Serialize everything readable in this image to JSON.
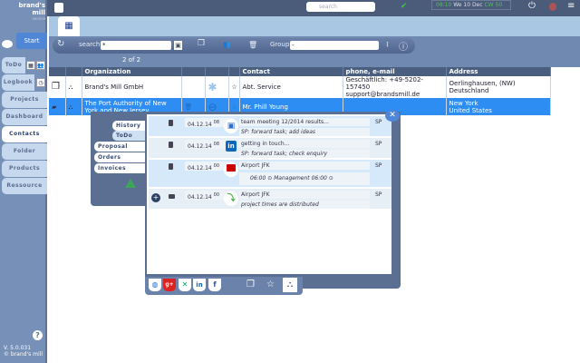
{
  "topbar": {
    "search_placeholder": "search",
    "time": "08:10",
    "date": "We 10 Dec",
    "week": "CW 50"
  },
  "sidebar": {
    "brand": "brand's mill",
    "brand_sub": "service",
    "start": "Start",
    "items": [
      "ToDo",
      "Logbook",
      "Projects",
      "Dashboard",
      "Contacts",
      "Folder",
      "Products",
      "Ressource"
    ],
    "active": "Contacts",
    "version": "V. 5.0.031",
    "copyright": "© brand's mill"
  },
  "toolbar": {
    "search_label": "search",
    "search_value": "*",
    "group_label": "Group",
    "group_value": "-",
    "count": "2 of 2"
  },
  "table": {
    "headers": [
      "Organization",
      "Contact",
      "phone, e-mail",
      "Address"
    ],
    "rows": [
      {
        "organization": "Brand's Mill GmbH",
        "contact": "Abt. Service",
        "phone": "Geschäftlich: +49-5202-157450",
        "email": "support@brandsmill.de",
        "address1": "Oerlinghausen, (NW)",
        "address2": "Deutschland",
        "selected": false
      },
      {
        "organization": "The Port Authority of New York and New Jersey",
        "contact": "Mr. Phill Young",
        "phone": "",
        "email": "",
        "address1": "New York",
        "address2": "United States",
        "selected": true
      }
    ]
  },
  "panel": {
    "tabs": [
      "History",
      "ToDo",
      "Proposal",
      "Orders",
      "Invoices"
    ],
    "activities": [
      {
        "date": "04.12.14",
        "time": "08",
        "icon": "contact-card-icon",
        "line1": "team meeting 12/2014 results...",
        "line2": "SP: forward task; add ideas",
        "user": "SP"
      },
      {
        "date": "04.12.14",
        "time": "08",
        "icon": "linkedin-icon",
        "line1": "getting in touch...",
        "line2": "SP: forward task; check enquiry",
        "user": "SP"
      },
      {
        "date": "04.12.14",
        "time": "00",
        "icon": "briefcase-icon",
        "line1": "Airport JFK",
        "line2": "06:00 ⊙ Management 06:00 ⊙",
        "user": "SP"
      },
      {
        "date": "04.12.14",
        "time": "00",
        "icon": "project-icon",
        "line1": "Airport JFK",
        "line2": "project times are distributed",
        "user": "SP"
      }
    ]
  },
  "colors": {
    "accent": "#2e8df2",
    "sidebar": "#7690b8",
    "header": "#4a5f80"
  }
}
